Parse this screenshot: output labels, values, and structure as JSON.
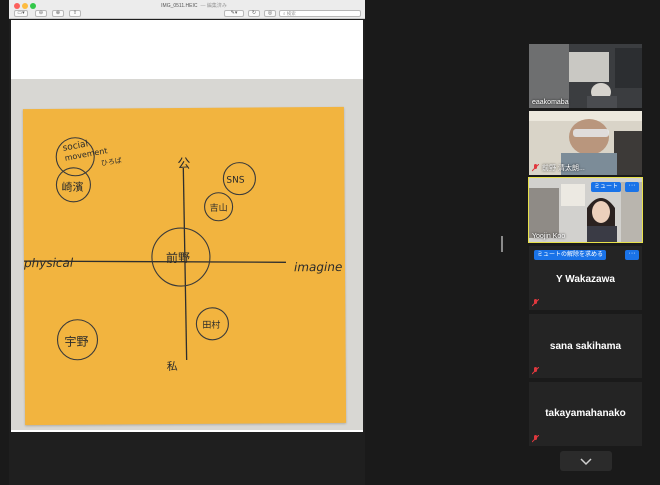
{
  "preview": {
    "title": "IMG_0511.HEIC",
    "title_status": "— 編集済み",
    "search_placeholder": "検索"
  },
  "note": {
    "word_top_left_1": "social",
    "word_top_left_2": "movement",
    "word_top_left_3": "ひろば",
    "name_ikezawa": "崎濱",
    "label_top": "公",
    "sns": "SNS",
    "name_shikayama": "吉山",
    "center_name": "前野",
    "physical": "physical",
    "imagine": "imagine",
    "name_tamura": "田村",
    "name_uno": "宇野",
    "label_bottom": "私"
  },
  "gallery": {
    "participants": [
      {
        "name": "eaakomaba",
        "muted": false
      },
      {
        "name": "前野 清太朗...",
        "muted": true
      },
      {
        "name": "Yoojin Koo",
        "muted": false,
        "active": true,
        "mute_button": "ミュート"
      },
      {
        "name": "Y Wakazawa",
        "muted": true,
        "request_button": "ミュートの解除を求める"
      },
      {
        "name": "sana sakihama",
        "muted": true
      },
      {
        "name": "takayamahanako",
        "muted": true
      }
    ],
    "more_label": "···",
    "scroll_down": "chevron-down-icon"
  }
}
